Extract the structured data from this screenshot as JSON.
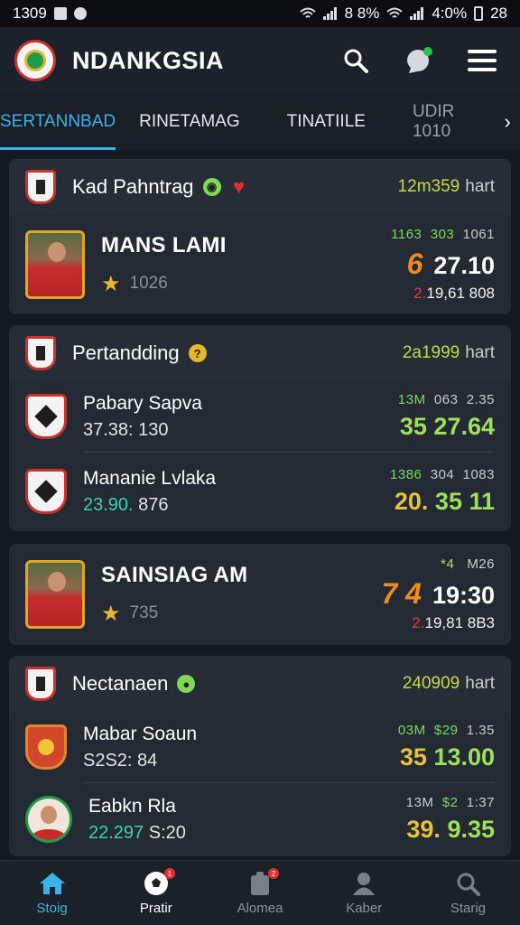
{
  "status": {
    "time": "1309",
    "right_text": "8 8%",
    "battery": "4:0%",
    "extra": "28"
  },
  "app": {
    "title": "NDANKGSIA"
  },
  "tabs": [
    {
      "label": "SERTANNBAD"
    },
    {
      "label": "RINETAMAG"
    },
    {
      "label": "TINATIILE"
    },
    {
      "label": "UDIR 1010"
    }
  ],
  "featured1": {
    "header_title": "Kad Pahntrag",
    "header_num": "12m359",
    "header_unit": "hart",
    "player_name": "MANS LAMI",
    "rating": "1026",
    "nums_a": "1163",
    "nums_b": "303",
    "nums_c": "1061",
    "big_odd": "6",
    "big_score": "27.10",
    "sub_prefix": "2.",
    "sub_value": "19,61 808"
  },
  "group1": {
    "title": "Pertandding",
    "meta_num": "2a1999",
    "meta_unit": "hart",
    "rows": [
      {
        "name": "Pabary Sapva",
        "sub_a": "37.38:",
        "sub_b": "130",
        "n1": "13M",
        "n2": "063",
        "n3": "2.35",
        "big_a": "35",
        "big_b": "27.64"
      },
      {
        "name": "Mananie Lvlaka",
        "sub_a": "23.90.",
        "sub_b": "876",
        "n1": "1386",
        "n2": "304",
        "n3": "1083",
        "big_a": "20.",
        "big_b": "35 11"
      }
    ]
  },
  "featured2": {
    "player_name": "SAINSIAG AM",
    "rating": "735",
    "nums_a": "*4",
    "nums_b": "M26",
    "big_odd": "7 4",
    "big_score": "19:30",
    "sub_prefix": "2.",
    "sub_value": "19,81 8B3"
  },
  "group2": {
    "title": "Nectanaen",
    "meta_num": "240909",
    "meta_unit": "hart",
    "rows": [
      {
        "name": "Mabar Soaun",
        "sub_a": "S2S2:",
        "sub_b": "84",
        "n1": "03M",
        "n2": "$29",
        "n3": "1.35",
        "big_a": "35",
        "big_b": "13.00"
      },
      {
        "name": "Eabkn Rla",
        "sub_a": "22.297",
        "sub_b": "S:20",
        "n1": "13M",
        "n2": "$2",
        "n3": "1:37",
        "big_a": "39.",
        "big_b": "9.35"
      }
    ]
  },
  "bottom_nav": [
    {
      "label": "Stoig",
      "icon": "home-icon"
    },
    {
      "label": "Pratir",
      "icon": "soccer-ball-icon"
    },
    {
      "label": "Alomea",
      "icon": "notification-icon"
    },
    {
      "label": "Kaber",
      "icon": "user-icon"
    },
    {
      "label": "Starig",
      "icon": "search-icon"
    }
  ],
  "colors": {
    "accent": "#3ab4e8",
    "background": "#141820",
    "card": "#232a33",
    "yellow_green": "#c9d84a",
    "green": "#9fe05a",
    "orange": "#f08a1e",
    "red": "#e33a3a"
  }
}
